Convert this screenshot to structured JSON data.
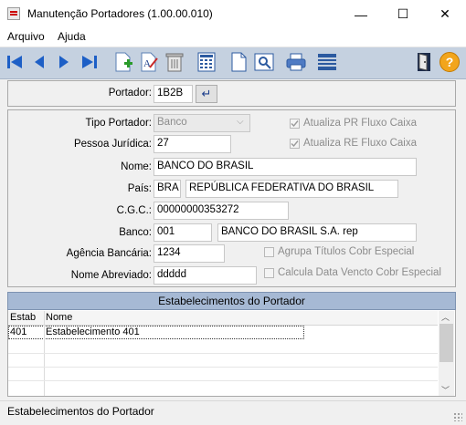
{
  "window": {
    "title": "Manutenção Portadores (1.00.00.010)",
    "minimize_glyph": "—",
    "maximize_glyph": "☐",
    "close_glyph": "✕"
  },
  "menu": {
    "items": [
      "Arquivo",
      "Ajuda"
    ]
  },
  "toolbar": {
    "icons": [
      "first-record-icon",
      "previous-record-icon",
      "next-record-icon",
      "last-record-icon",
      "new-record-icon",
      "edit-record-icon",
      "delete-icon",
      "calculator-icon",
      "document-icon",
      "preview-icon",
      "print-icon",
      "list-icon",
      "exit-icon",
      "help-icon"
    ],
    "help_glyph": "?"
  },
  "portador": {
    "label": "Portador:",
    "value": "1B2B",
    "go_glyph": "↵"
  },
  "form": {
    "tipo_portador": {
      "label": "Tipo Portador:",
      "value": "Banco"
    },
    "pessoa_juridica": {
      "label": "Pessoa Jurídica:",
      "value": "27"
    },
    "nome": {
      "label": "Nome:",
      "value": "BANCO DO BRASIL"
    },
    "pais": {
      "label": "País:",
      "code": "BRA",
      "name": "REPÚBLICA FEDERATIVA DO BRASIL"
    },
    "cgc": {
      "label": "C.G.C.:",
      "value": "00000000353272"
    },
    "banco": {
      "label": "Banco:",
      "code": "001",
      "name": "BANCO DO BRASIL S.A. rep"
    },
    "agencia": {
      "label": "Agência Bancária:",
      "value": "1234"
    },
    "nome_abreviado": {
      "label": "Nome Abreviado:",
      "value": "ddddd"
    },
    "checks": {
      "atualiza_pr": {
        "label": "Atualiza PR Fluxo Caixa",
        "checked": true
      },
      "atualiza_re": {
        "label": "Atualiza RE Fluxo Caixa",
        "checked": true
      },
      "agrupa_titulos": {
        "label": "Agrupa Títulos Cobr Especial",
        "checked": false
      },
      "calcula_data": {
        "label": "Calcula Data Vencto Cobr Especial",
        "checked": false
      }
    }
  },
  "estab_grid": {
    "title": "Estabelecimentos do Portador",
    "columns": [
      "Estab",
      "Nome"
    ],
    "rows": [
      {
        "estab": "401",
        "nome": "Estabelecimento 401"
      }
    ]
  },
  "status": {
    "text": "Estabelecimentos do Portador"
  }
}
